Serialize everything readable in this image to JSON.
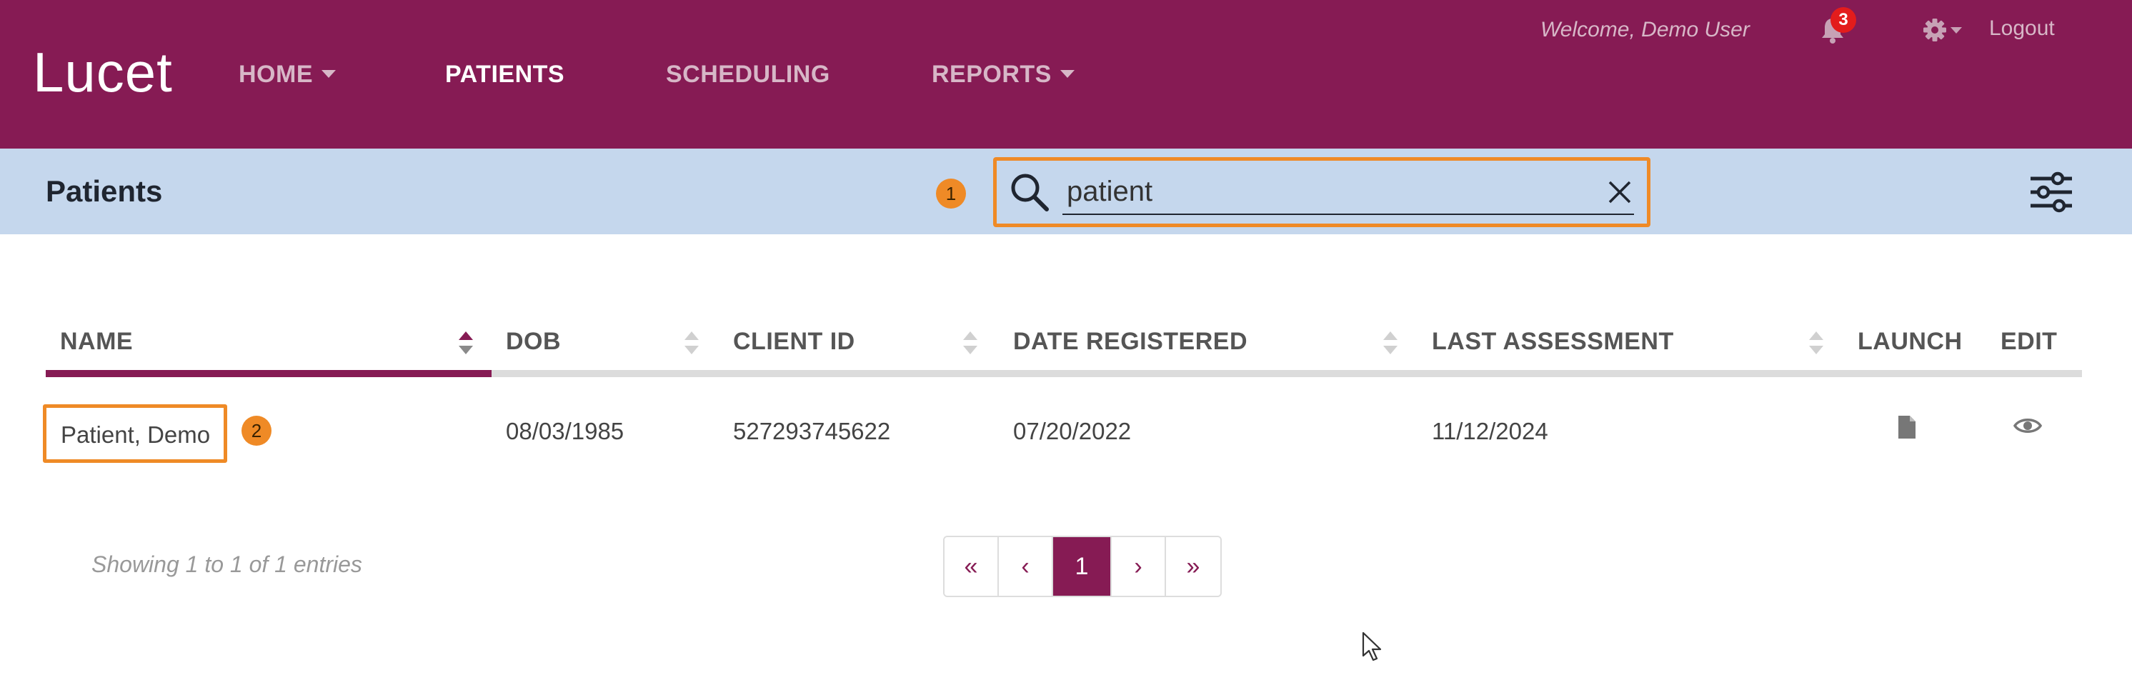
{
  "brand": {
    "logo_text": "Lucet",
    "primary_color": "#861b54",
    "subbar_color": "#c5d7ed",
    "highlight_color": "#ef8a26"
  },
  "nav": {
    "items": [
      {
        "label": "HOME",
        "has_dropdown": true
      },
      {
        "label": "PATIENTS",
        "active": true
      },
      {
        "label": "SCHEDULING"
      },
      {
        "label": "REPORTS",
        "has_dropdown": true
      }
    ],
    "welcome": "Welcome, Demo User",
    "notification_count": "3",
    "logout_label": "Logout",
    "icons": [
      "bell-icon",
      "gear-icon"
    ]
  },
  "subheader": {
    "title": "Patients",
    "search": {
      "value": "patient",
      "step": "1"
    }
  },
  "table": {
    "columns": [
      "NAME",
      "DOB",
      "CLIENT ID",
      "DATE REGISTERED",
      "LAST ASSESSMENT",
      "LAUNCH",
      "EDIT"
    ],
    "sorted_column": "NAME",
    "rows": [
      {
        "name": "Patient, Demo",
        "dob": "08/03/1985",
        "client_id": "527293745622",
        "date_registered": "07/20/2022",
        "last_assessment": "11/12/2024",
        "step": "2"
      }
    ]
  },
  "footer": {
    "showing": "Showing 1 to 1 of 1 entries",
    "pagination": {
      "first": "«",
      "prev": "‹",
      "current": "1",
      "next": "›",
      "last": "»"
    }
  }
}
